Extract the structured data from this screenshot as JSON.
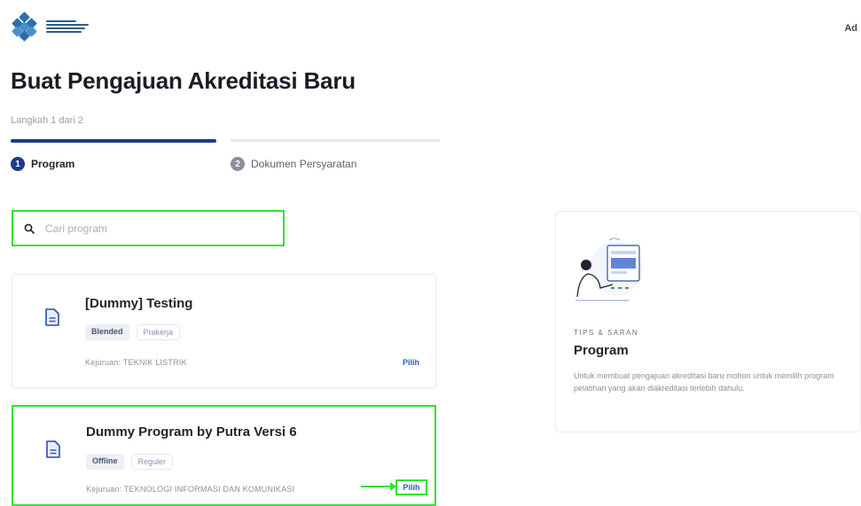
{
  "header": {
    "user_initial": "Ad"
  },
  "page": {
    "title": "Buat Pengajuan Akreditasi Baru",
    "step_indicator": "Langkah 1 dari 2"
  },
  "stepper": [
    {
      "number": "1",
      "label": "Program",
      "active": true
    },
    {
      "number": "2",
      "label": "Dokumen Persyaratan",
      "active": false
    }
  ],
  "search": {
    "placeholder": "Cari program",
    "value": ""
  },
  "programs": [
    {
      "title": "[Dummy] Testing",
      "tags": [
        "Blended",
        "Prakerja"
      ],
      "subtitle": "Kejuruan: TEKNIK LISTRIK",
      "action": "Pilih"
    },
    {
      "title": "Dummy Program by Putra Versi 6",
      "tags": [
        "Offline",
        "Reguler"
      ],
      "subtitle": "Kejuruan: TEKNOLOGI INFORMASI DAN KOMUNIKASI",
      "action": "Pilih"
    }
  ],
  "tips": {
    "kicker": "TIPS & SARAN",
    "title": "Program",
    "description": "Untuk membuat pengajuan akreditasi baru mohon untuk memilih program pelatihan yang akan diakreditasi terlebih dahulu."
  },
  "colors": {
    "primary": "#1d3a8a",
    "highlight": "#2ee52e",
    "link": "#2b5fb5"
  }
}
